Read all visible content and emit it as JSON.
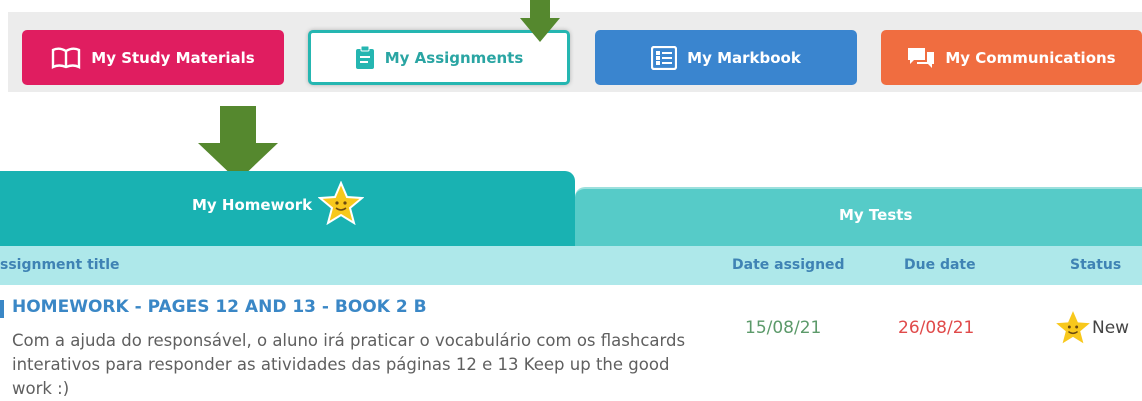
{
  "nav": {
    "study_materials": "My Study Materials",
    "assignments": "My Assignments",
    "markbook": "My Markbook",
    "communications": "My Communications"
  },
  "tabs": {
    "homework": "My Homework",
    "tests": "My Tests"
  },
  "table": {
    "headers": {
      "title": "ssignment title",
      "date_assigned": "Date assigned",
      "due_date": "Due date",
      "status": "Status"
    },
    "rows": [
      {
        "title": "HOMEWORK - PAGES 12 AND 13 - BOOK 2 B",
        "description": "Com a ajuda do responsável, o aluno irá praticar o vocabulário com os flashcards interativos para responder as atividades das páginas 12 e 13 Keep up the good work :)",
        "date_assigned": "15/08/21",
        "due_date": "26/08/21",
        "status": "New"
      }
    ]
  },
  "colors": {
    "study": "#e01d60",
    "assign_border": "#25b6b1",
    "markbook": "#3a85cf",
    "communications": "#f06d40",
    "tab_active": "#19b2b2",
    "tab_inactive": "#56cbc8",
    "header_bg": "#aee8ea",
    "date_assigned": "#5c9a6a",
    "due_date": "#e04a4a",
    "arrow": "#55882e"
  }
}
